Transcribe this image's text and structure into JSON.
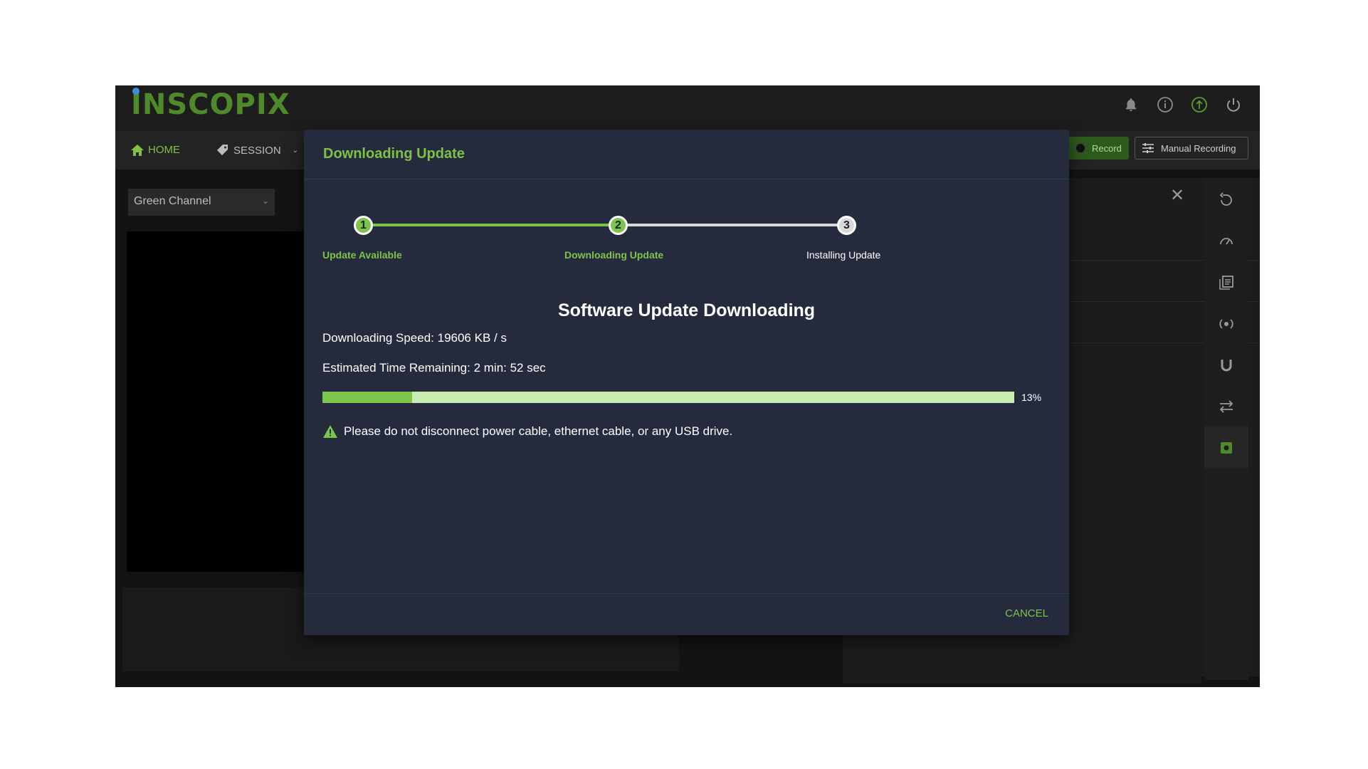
{
  "app": {
    "logo": "INSCOPIX",
    "nav": {
      "home": "HOME",
      "session": "SESSION"
    },
    "record_label": "Record",
    "manual_label": "Manual Recording",
    "channel": "Green Channel",
    "colors": {
      "accent": "#7cc54a",
      "modal_bg": "#252a3d",
      "app_bg": "#131313"
    }
  },
  "dialog": {
    "title": "Downloading Update",
    "steps": [
      {
        "number": "1",
        "label": "Update Available",
        "state": "done"
      },
      {
        "number": "2",
        "label": "Downloading Update",
        "state": "active"
      },
      {
        "number": "3",
        "label": "Installing Update",
        "state": "pending"
      }
    ],
    "heading": "Software Update Downloading",
    "speed": "Downloading Speed: 19606 KB / s",
    "eta": "Estimated Time Remaining: 2 min: 52 sec",
    "progress": {
      "fraction": 0.13,
      "label": "13%"
    },
    "warning": "Please do not disconnect power cable, ethernet cable, or any USB drive.",
    "cancel_label": "CANCEL"
  }
}
